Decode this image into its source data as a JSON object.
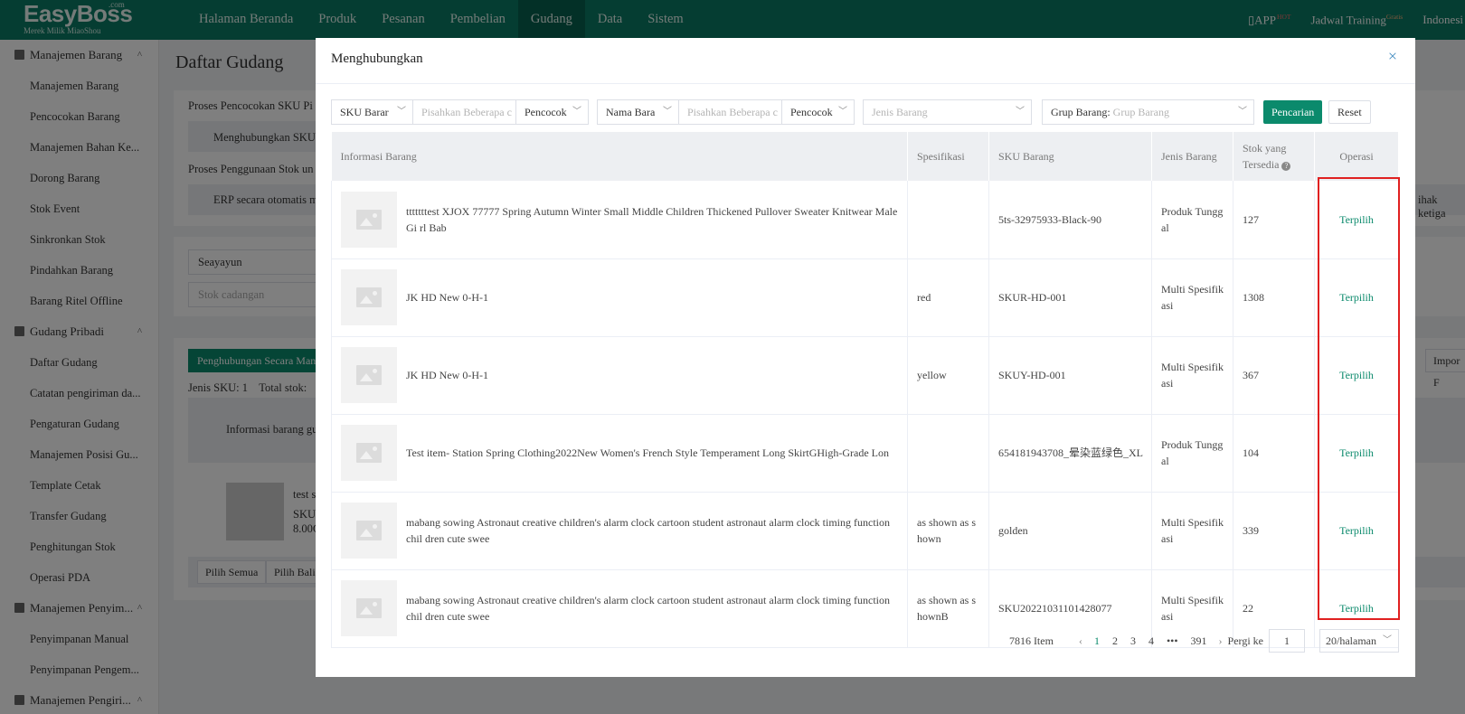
{
  "topbar": {
    "logo": "EasyBoss",
    "logo_com": ".com",
    "logo_sub": "Merek Milik MiaoShou",
    "nav": [
      "Halaman Beranda",
      "Produk",
      "Pesanan",
      "Pembelian",
      "Gudang",
      "Data",
      "Sistem"
    ],
    "active_nav": "Gudang",
    "app": "APP",
    "app_badge": "HOT",
    "training": "Jadwal Training",
    "training_badge": "Gratis",
    "language": "Indonesi"
  },
  "sidebar": {
    "groups": [
      {
        "label": "Manajemen Barang",
        "chev": "^",
        "items": [
          "Manajemen Barang",
          "Pencocokan Barang",
          "Manajemen Bahan Ke...",
          "Dorong Barang",
          "Stok Event",
          "Sinkronkan Stok",
          "Pindahkan Barang",
          "Barang Ritel Offline"
        ]
      },
      {
        "label": "Gudang Pribadi",
        "chev": "^",
        "items": [
          "Daftar Gudang",
          "Catatan pengiriman da...",
          "Pengaturan Gudang",
          "Manajemen Posisi Gu...",
          "Template Cetak",
          "Transfer Gudang",
          "Penghitungan Stok",
          "Operasi PDA"
        ]
      },
      {
        "label": "Manajemen Penyim...",
        "chev": "^",
        "items": [
          "Penyimpanan Manual",
          "Penyimpanan Pengem..."
        ]
      },
      {
        "label": "Manajemen Pengiri...",
        "chev": "^",
        "items": []
      }
    ]
  },
  "background": {
    "page_title": "Daftar Gudang",
    "proses1": "Proses Pencocokan SKU Pi",
    "btn_hubung": "Menghubungkan SKU",
    "proses2": "Proses Penggunaan Stok un",
    "erp_text": "ERP secara otomatis m",
    "right_text": "ihak ketiga",
    "seayayun": "Seayayun",
    "stok_cadangan": "Stok cadangan",
    "btn_manual": "Penghubungan Secara Manu",
    "btn_impor": "Impor F",
    "jenis_sku": "Jenis SKU:",
    "jenis_sku_val": "1",
    "total_stok": "Total stok:",
    "col_info": "Informasi barang gud",
    "row_name": "test st",
    "row_sku": "SKU I",
    "row_val": "8.00G",
    "btn_pilih_semua": "Pilih Semua",
    "btn_pilih_balik": "Pilih Balik"
  },
  "modal": {
    "title": "Menghubungkan",
    "close": "×",
    "filters": {
      "sku_select": "SKU Barar",
      "sku_placeholder": "Pisahkan Beberapa c",
      "sku_match": "Pencocok",
      "name_select": "Nama Bara",
      "name_placeholder": "Pisahkan Beberapa c",
      "name_match": "Pencocok",
      "type_placeholder": "Jenis Barang",
      "group_label": "Grup Barang:",
      "group_placeholder": "Grup Barang",
      "search": "Pencarian",
      "reset": "Reset"
    },
    "table": {
      "headers": [
        "Informasi Barang",
        "Spesifikasi",
        "SKU Barang",
        "Jenis Barang",
        "Stok yang Tersedia",
        "Operasi"
      ],
      "rows": [
        {
          "info": "tttttttest XJOX 77777 Spring Autumn Winter Small Middle Children Thickened Pullover Sweater Knitwear Male Gi rl Bab",
          "spec": "",
          "sku": "5ts-32975933-Black-90",
          "type": "Produk Tungg al",
          "stock": "127",
          "op": "Terpilih"
        },
        {
          "info": "JK HD New 0-H-1",
          "spec": "red",
          "sku": "SKUR-HD-001",
          "type": "Multi Spesifik asi",
          "stock": "1308",
          "op": "Terpilih"
        },
        {
          "info": "JK HD New 0-H-1",
          "spec": "yellow",
          "sku": "SKUY-HD-001",
          "type": "Multi Spesifik asi",
          "stock": "367",
          "op": "Terpilih"
        },
        {
          "info": "Test item- Station Spring Clothing2022New Women's French Style Temperament Long SkirtGHigh-Grade Lon",
          "spec": "",
          "sku": "654181943708_晕染蓝绿色_XL",
          "type": "Produk Tungg al",
          "stock": "104",
          "op": "Terpilih"
        },
        {
          "info": "mabang sowing Astronaut creative children's alarm clock cartoon student astronaut alarm clock timing function chil dren cute swee",
          "spec": "as shown as s hown",
          "sku": "golden",
          "type": "Multi Spesifik asi",
          "stock": "339",
          "op": "Terpilih"
        },
        {
          "info": "mabang sowing Astronaut creative children's alarm clock cartoon student astronaut alarm clock timing function chil dren cute swee",
          "spec": "as shown as s hownB",
          "sku": "SKU20221031101428077",
          "type": "Multi Spesifik asi",
          "stock": "22",
          "op": "Terpilih"
        }
      ]
    },
    "pager": {
      "total": "7816 Item",
      "pages": [
        "1",
        "2",
        "3",
        "4",
        "•••",
        "391"
      ],
      "current": "1",
      "goto_label": "Pergi ke",
      "goto_value": "1",
      "page_size": "20/halaman"
    }
  }
}
